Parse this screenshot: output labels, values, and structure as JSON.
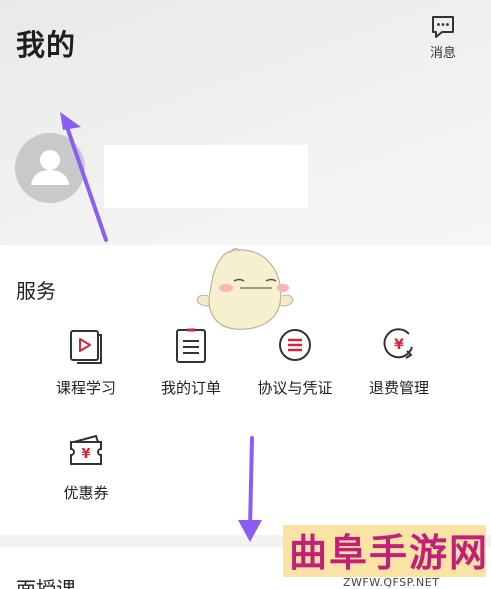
{
  "header": {
    "title": "我的",
    "message_label": "消息"
  },
  "services": {
    "title": "服务",
    "items": [
      {
        "label": "课程学习",
        "icon": "course-play-icon"
      },
      {
        "label": "我的订单",
        "icon": "order-list-icon"
      },
      {
        "label": "协议与凭证",
        "icon": "agreement-icon"
      },
      {
        "label": "退费管理",
        "icon": "refund-icon"
      },
      {
        "label": "优惠券",
        "icon": "coupon-icon"
      }
    ]
  },
  "next_section": {
    "title": "面授课"
  },
  "watermark": {
    "text": "曲阜手游网",
    "url": "ZWFW.QFSP.NET"
  },
  "colors": {
    "accent": "#d0283a",
    "arrow": "#8b5cf6"
  }
}
